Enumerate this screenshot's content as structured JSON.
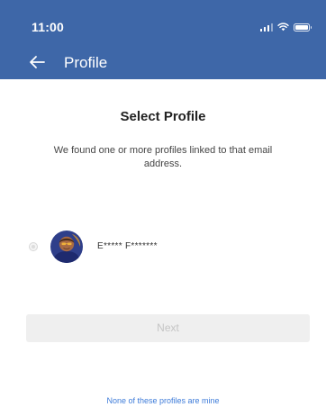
{
  "status_bar": {
    "time": "11:00",
    "icons": [
      "signal-icon",
      "wifi-icon",
      "battery-icon"
    ]
  },
  "nav": {
    "back_icon": "arrow-left-icon",
    "title": "Profile"
  },
  "main": {
    "title": "Select Profile",
    "description": "We found one or more profiles linked to that email address.",
    "profiles": [
      {
        "name": "E***** F*******",
        "selected": false
      }
    ],
    "next_label": "Next",
    "none_link": "None of these profiles are mine"
  },
  "colors": {
    "header": "#3e67a8",
    "link": "#3d7bd9",
    "button_disabled_bg": "#efefef",
    "button_disabled_text": "#c4c4c4"
  }
}
